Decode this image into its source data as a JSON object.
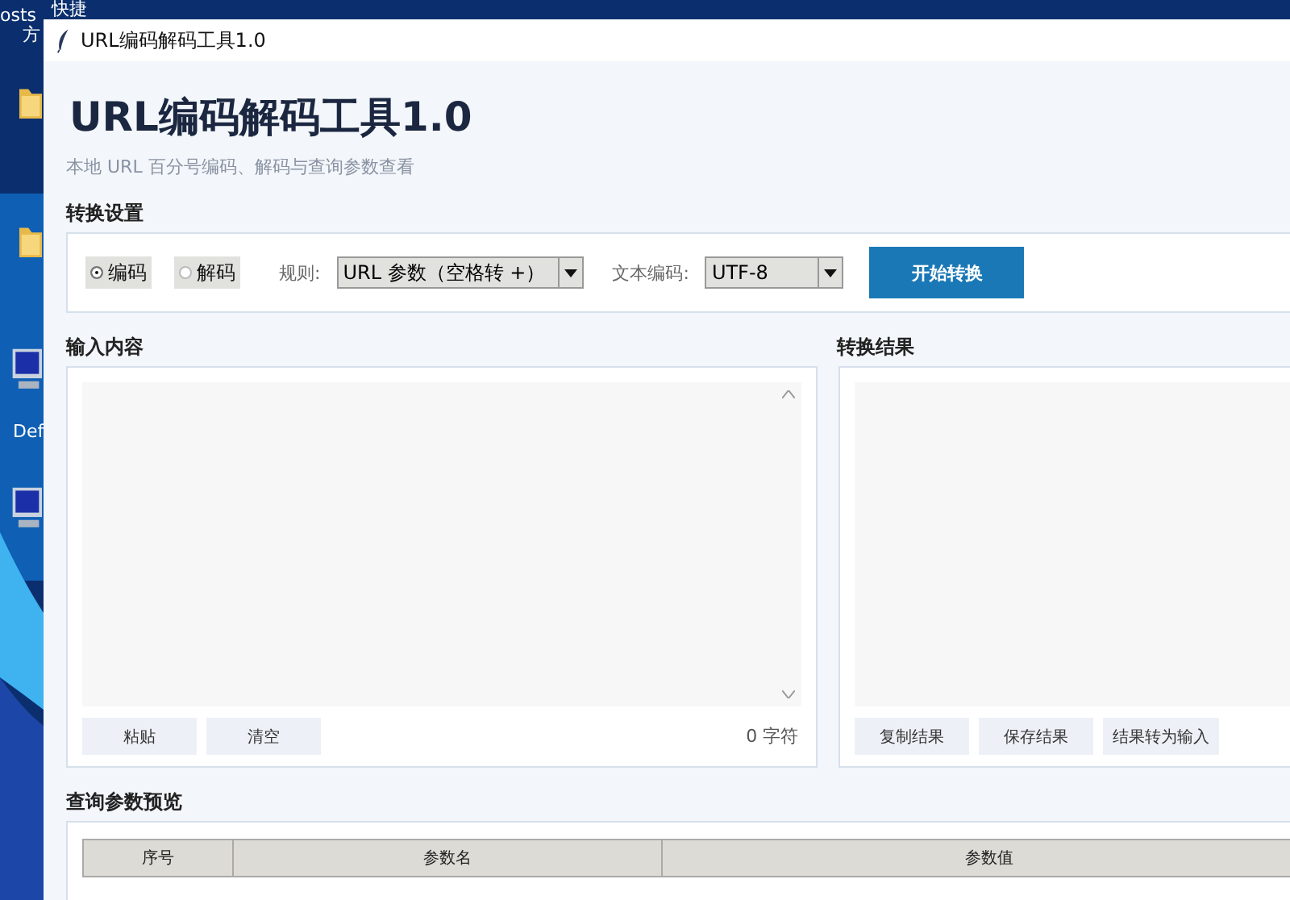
{
  "desktop": {
    "labels": [
      "osts",
      "快捷",
      "方",
      "Def"
    ]
  },
  "window": {
    "title": "URL编码解码工具1.0"
  },
  "header": {
    "title": "URL编码解码工具1.0",
    "subtitle": "本地 URL 百分号编码、解码与查询参数查看"
  },
  "settings": {
    "label": "转换设置",
    "modes": [
      {
        "label": "编码",
        "selected": true
      },
      {
        "label": "解码",
        "selected": false
      }
    ],
    "rule_label": "规则:",
    "rule_value": "URL 参数（空格转 +）",
    "encoding_label": "文本编码:",
    "encoding_value": "UTF-8",
    "start_button": "开始转换"
  },
  "input": {
    "label": "输入内容",
    "buttons": [
      "粘贴",
      "清空"
    ],
    "count": "0 字符"
  },
  "result": {
    "label": "转换结果",
    "buttons": [
      "复制结果",
      "保存结果",
      "结果转为输入"
    ]
  },
  "query": {
    "label": "查询参数预览",
    "table": {
      "columns": [
        "序号",
        "参数名",
        "参数值"
      ]
    }
  }
}
